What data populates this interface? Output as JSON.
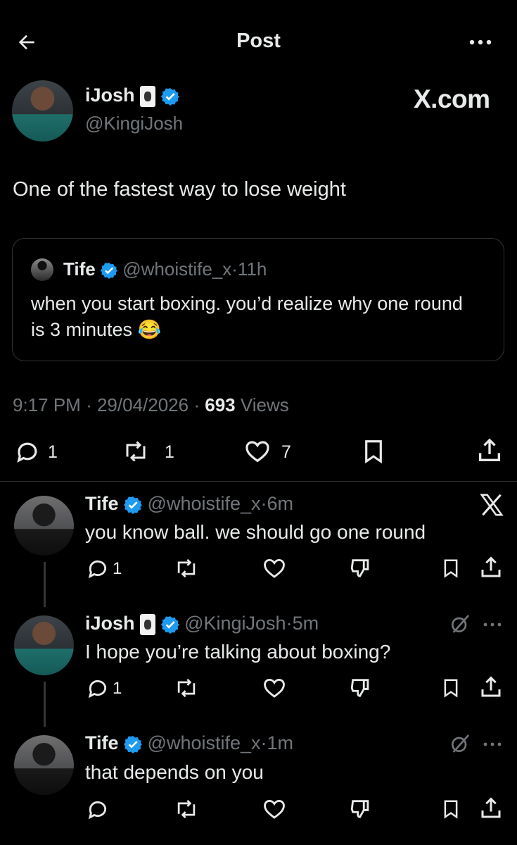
{
  "header": {
    "title": "Post"
  },
  "watermark": "X.com",
  "main_post": {
    "name": "iJosh",
    "handle": "@KingiJosh",
    "text": "One of the fastest way to lose weight",
    "quote": {
      "name": "Tife",
      "handle": "@whoistife_x",
      "time": "11h",
      "text": "when you start boxing. you’d realize why one round is 3 minutes 😂"
    },
    "meta": {
      "time": "9:17 PM",
      "date": "29/04/2026",
      "views": "693",
      "views_label": "Views"
    },
    "stats": {
      "replies": "1",
      "reposts": "1",
      "likes": "7"
    }
  },
  "replies": [
    {
      "name": "Tife",
      "handle": "@whoistife_x",
      "time": "6m",
      "text": "you know ball. we should go one round",
      "replies": "1"
    },
    {
      "name": "iJosh",
      "handle": "@KingiJosh",
      "time": "5m",
      "text": "I hope you’re talking about boxing?",
      "replies": "1"
    },
    {
      "name": "Tife",
      "handle": "@whoistife_x",
      "time": "1m",
      "text": "that depends on you",
      "replies": ""
    }
  ],
  "separator": "·",
  "colors": {
    "background": "#000000",
    "verified": "#1d9bf0",
    "muted": "#71767b",
    "text": "#e7e9ea"
  }
}
